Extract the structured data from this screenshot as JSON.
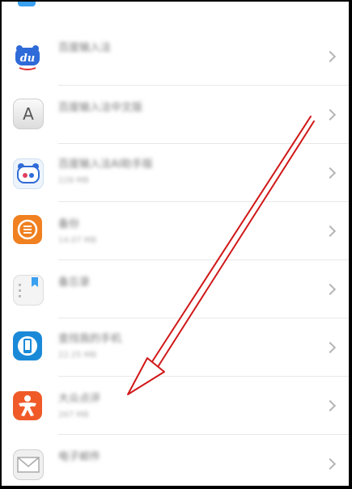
{
  "apps": [
    {
      "name": "百度输入法",
      "size": ""
    },
    {
      "name": "百度输入法中文版",
      "size": ""
    },
    {
      "name": "百度输入法AI助手版",
      "size": "228 MB"
    },
    {
      "name": "备份",
      "size": "14.07 MB"
    },
    {
      "name": "备忘录",
      "size": ""
    },
    {
      "name": "查找我的手机",
      "size": "22.25 MB"
    },
    {
      "name": "大众点评",
      "size": "267 MB"
    },
    {
      "name": "电子邮件",
      "size": ""
    }
  ],
  "icons": {
    "baidu": {
      "label": "du",
      "color": "#2f6bd8"
    },
    "keyboard": {
      "label": "A",
      "color": "#666666"
    },
    "ai": {
      "color": "#2f6bd8"
    },
    "backup": {
      "color": "#f08020"
    },
    "memo": {
      "color": "#3aa0f0"
    },
    "findphone": {
      "color": "#1a8ad8"
    },
    "dianping": {
      "color": "#f05a28"
    },
    "email": {
      "color": "#bdbdbd"
    }
  },
  "annotation": {
    "color": "#d01818"
  }
}
